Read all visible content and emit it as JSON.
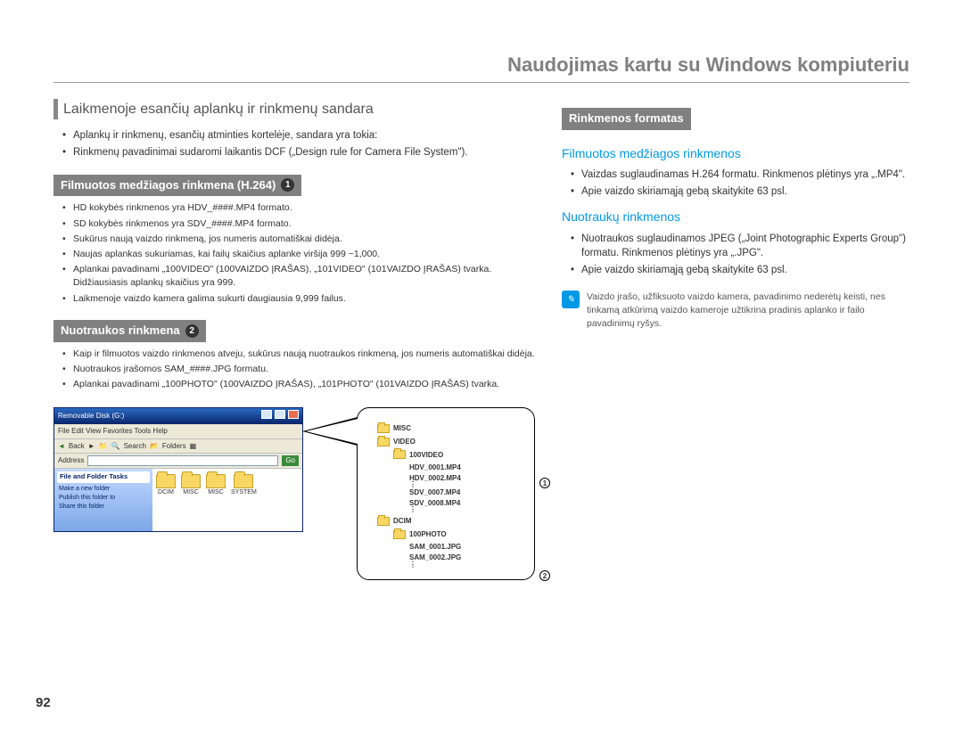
{
  "header": "Naudojimas kartu su Windows kompiuteriu",
  "pageNumber": "92",
  "left": {
    "title": "Laikmenoje esančių aplankų ir rinkmenų sandara",
    "intro": [
      "Aplankų ir rinkmenų, esančių atminties kortelėje, sandara yra tokia:",
      "Rinkmenų pavadinimai sudaromi laikantis DCF („Design rule for Camera File System\")."
    ],
    "section1Label": "Filmuotos medžiagos rinkmena (H.264)",
    "section1Num": "1",
    "section1Items": [
      "HD kokybės rinkmenos yra HDV_####.MP4 formato.",
      "SD kokybės rinkmenos yra SDV_####.MP4 formato.",
      "Sukūrus naują vaizdo rinkmeną, jos numeris automatiškai didėja.",
      "Naujas aplankas sukuriamas, kai failų skaičius aplanke viršija 999 ~1,000.",
      "Aplankai pavadinami „100VIDEO\" (100VAIZDO ĮRAŠAS), „101VIDEO\" (101VAIZDO ĮRAŠAS) tvarka. Didžiausiasis aplankų skaičius yra 999.",
      "Laikmenoje vaizdo kamera galima sukurti daugiausia 9,999 failus."
    ],
    "section2Label": "Nuotraukos rinkmena",
    "section2Num": "2",
    "section2Items": [
      "Kaip ir filmuotos vaizdo rinkmenos atveju, sukūrus naują nuotraukos rinkmeną, jos numeris automatiškai didėja.",
      "Nuotraukos įrašomos SAM_####.JPG formatu.",
      "Aplankai pavadinami „100PHOTO\" (100VAIZDO ĮRAŠAS), „101PHOTO\" (101VAIZDO ĮRAŠAS) tvarka."
    ]
  },
  "right": {
    "section1Label": "Rinkmenos formatas",
    "sub1": "Filmuotos medžiagos rinkmenos",
    "sub1Items": [
      "Vaizdas suglaudinamas H.264 formatu. Rinkmenos plėtinys yra „.MP4\".",
      "Apie vaizdo skiriamąją gebą skaitykite 63 psl."
    ],
    "sub2": "Nuotraukų rinkmenos",
    "sub2Items": [
      "Nuotraukos suglaudinamos JPEG („Joint Photographic Experts Group\") formatu. Rinkmenos plėtinys yra „.JPG\".",
      "Apie vaizdo skiriamąją gebą skaitykite 63 psl."
    ],
    "note": "Vaizdo įrašo, užfiksuoto vaizdo kamera, pavadinimo nederėtų keisti, nes tinkamą atkūrimą vaizdo kameroje užtikrina pradinis aplanko ir failo pavadinimų ryšys."
  },
  "explorer": {
    "title": "Removable Disk (G:)",
    "menu": "File   Edit   View   Favorites   Tools   Help",
    "toolBack": "Back",
    "toolSearch": "Search",
    "toolFolders": "Folders",
    "addrLabel": "Address",
    "go": "Go",
    "sideHead": "File and Folder Tasks",
    "sideItems": [
      "Make a new folder",
      "Publish this folder to",
      "Share this folder"
    ],
    "folders": [
      "DCIM",
      "MISC",
      "MISC",
      "SYSTEM"
    ]
  },
  "tree": {
    "misc": "MISC",
    "video": "VIDEO",
    "video100": "100VIDEO",
    "hdv1": "HDV_0001.MP4",
    "hdv2": "HDV_0002.MP4",
    "sdv7": "SDV_0007.MP4",
    "sdv8": "SDV_0008.MP4",
    "dcim": "DCIM",
    "photo100": "100PHOTO",
    "sam1": "SAM_0001.JPG",
    "sam2": "SAM_0002.JPG",
    "circ1": "1",
    "circ2": "2"
  }
}
